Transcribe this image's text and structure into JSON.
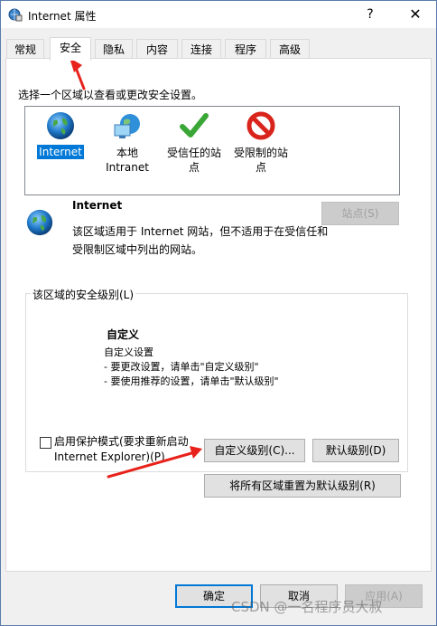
{
  "window": {
    "title": "Internet 属性",
    "help_glyph": "?",
    "close_glyph": "✕"
  },
  "tabs": [
    {
      "label": "常规",
      "active": false
    },
    {
      "label": "安全",
      "active": true
    },
    {
      "label": "隐私",
      "active": false
    },
    {
      "label": "内容",
      "active": false
    },
    {
      "label": "连接",
      "active": false
    },
    {
      "label": "程序",
      "active": false
    },
    {
      "label": "高级",
      "active": false
    }
  ],
  "security": {
    "prompt": "选择一个区域以查看或更改安全设置。",
    "zones": [
      {
        "label": "Internet",
        "icon": "globe-icon",
        "selected": true
      },
      {
        "label": "本地\nIntranet",
        "icon": "intranet-icon",
        "selected": false
      },
      {
        "label": "受信任的站\n点",
        "icon": "check-icon",
        "selected": false
      },
      {
        "label": "受限制的站\n点",
        "icon": "restricted-icon",
        "selected": false
      }
    ],
    "zone_info": {
      "name": "Internet",
      "description": "该区域适用于 Internet 网站，但不适用于在受信任和受限制区域中列出的网站。",
      "sites_button": "站点(S)"
    },
    "level_group": {
      "label": "该区域的安全级别(L)",
      "title": "自定义",
      "lines": [
        "自定义设置",
        "- 要更改设置，请单击\"自定义级别\"",
        "- 要使用推荐的设置，请单击\"默认级别\""
      ],
      "protected_mode": "启用保护模式(要求重新启动 Internet Explorer)(P)",
      "custom_button": "自定义级别(C)...",
      "default_button": "默认级别(D)"
    },
    "reset_all_button": "将所有区域重置为默认级别(R)"
  },
  "footer": {
    "ok": "确定",
    "cancel": "取消",
    "apply": "应用(A)"
  },
  "watermark": "CSDN @一名程序员大叔",
  "colors": {
    "accent": "#0078d7",
    "arrow": "#e8221b"
  }
}
